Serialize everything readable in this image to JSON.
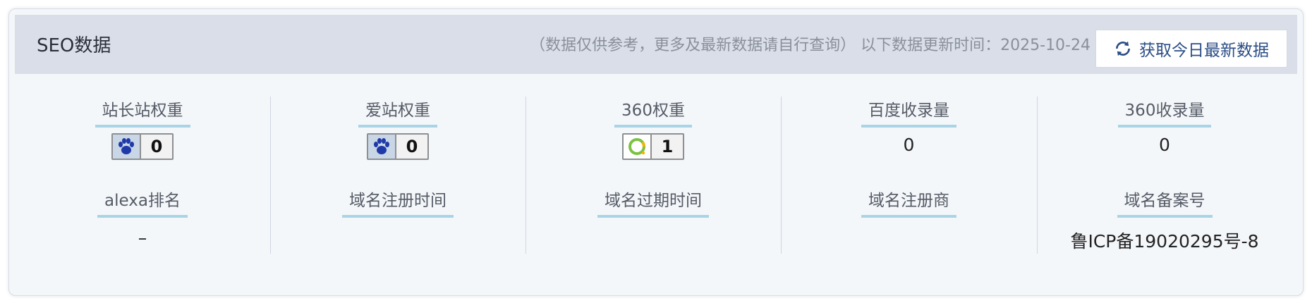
{
  "header": {
    "title": "SEO数据",
    "note": "（数据仅供参考，更多及最新数据请自行查询） 以下数据更新时间：2025-10-24",
    "refresh_label": "获取今日最新数据"
  },
  "metrics": {
    "zhanzhang_weight": {
      "label": "站长站权重",
      "value": "0"
    },
    "aizhan_weight": {
      "label": "爱站权重",
      "value": "0"
    },
    "weight_360": {
      "label": "360权重",
      "value": "1"
    },
    "baidu_index": {
      "label": "百度收录量",
      "value": "0"
    },
    "index_360": {
      "label": "360收录量",
      "value": "0"
    },
    "alexa": {
      "label": "alexa排名",
      "value": "–"
    },
    "reg_time": {
      "label": "域名注册时间",
      "value": ""
    },
    "expire_time": {
      "label": "域名过期时间",
      "value": ""
    },
    "registrar": {
      "label": "域名注册商",
      "value": ""
    },
    "icp": {
      "label": "域名备案号",
      "value": "鲁ICP备19020295号-8"
    }
  },
  "icons": {
    "baidu": "paw-icon",
    "q360": "360-logo-icon",
    "refresh": "refresh-icon"
  },
  "colors": {
    "header_bg": "#d9dee9",
    "label_underline": "#a9d4e6",
    "button_text": "#2b4d86"
  }
}
